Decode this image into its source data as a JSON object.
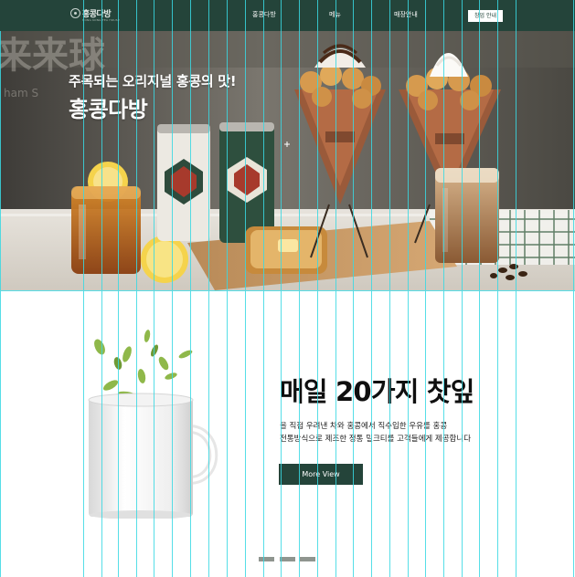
{
  "header": {
    "logo_name": "홍콩다방",
    "logo_sub": "HONG KONG TEA HOUSE",
    "nav": [
      "홍콩다방",
      "메뉴",
      "매장안내"
    ],
    "cta_label": "창업 안내"
  },
  "hero": {
    "subtitle": "주목되는 오리지널 홍콩의 맛!",
    "title": "홍콩다방"
  },
  "feature": {
    "title": "매일 20가지 찻잎",
    "desc_line1": "을 직접 우려낸 차와 홍콩에서 직수입한 우유를 홍콩",
    "desc_line2": "전통방식으로 제조한 정통 밀크티를 고객들에게 제공합니다",
    "button_label": "More View"
  },
  "slider": {
    "count": 3
  },
  "colors": {
    "brand_dark_green": "#24443a",
    "text_dark": "#0f0f0f",
    "guide_cyan": "#39d9e3",
    "indicator_gray": "#8f958f"
  }
}
